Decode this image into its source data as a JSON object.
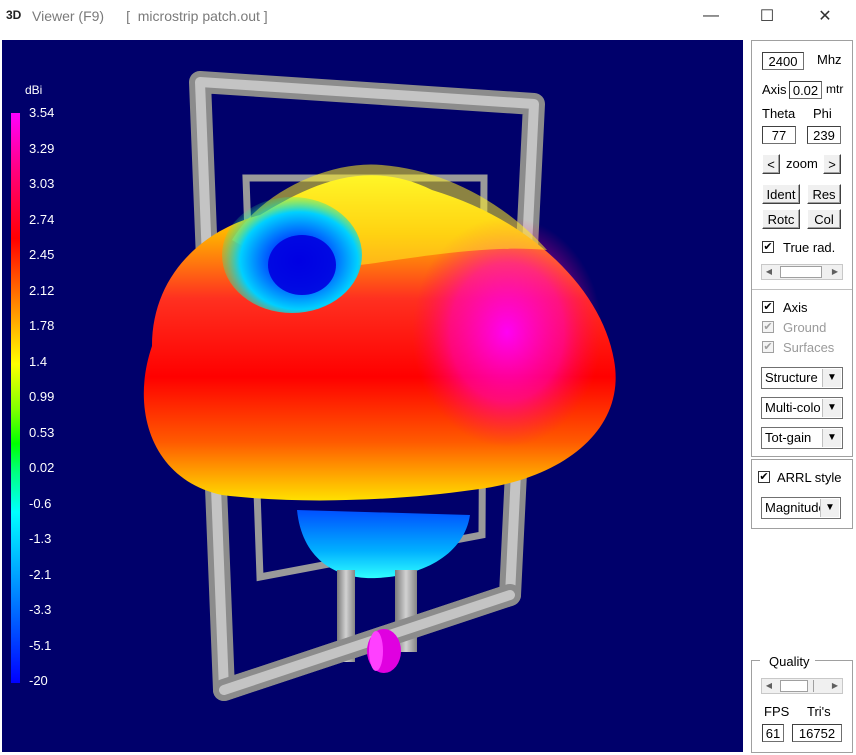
{
  "window": {
    "icon_text": "3D",
    "title": "Viewer (F9)",
    "file": "[  microstrip patch.out ]",
    "minimize_label": "—",
    "maximize_label": "☐",
    "close_label": "✕"
  },
  "colorbar": {
    "unit": "dBi",
    "ticks": [
      "3.54",
      "3.29",
      "3.03",
      "2.74",
      "2.45",
      "2.12",
      "1.78",
      "1.4",
      "0.99",
      "0.53",
      "0.02",
      "-0.6",
      "-1.3",
      "-2.1",
      "-3.3",
      "-5.1",
      "-20"
    ]
  },
  "controls": {
    "freq_value": "2400",
    "freq_unit": "Mhz",
    "axis_label": "Axis",
    "axis_value": "0.02",
    "axis_unit": "mtr",
    "theta_label": "Theta",
    "phi_label": "Phi",
    "theta_value": "77",
    "phi_value": "239",
    "zoom_left": "<",
    "zoom_label": "zoom",
    "zoom_right": ">",
    "ident_label": "Ident",
    "res_label": "Res",
    "rotc_label": "Rotc",
    "col_label": "Col",
    "true_rad_label": "True rad.",
    "true_rad_checked": true,
    "axis_check_label": "Axis",
    "axis_checked": true,
    "ground_label": "Ground",
    "surfaces_label": "Surfaces",
    "structure_select": "Structure",
    "color_select": "Multi-colo",
    "gain_select": "Tot-gain",
    "arrl_label": "ARRL style",
    "arrl_checked": true,
    "magnitude_select": "Magnitude",
    "quality_label": "Quality",
    "fps_label": "FPS",
    "tris_label": "Tri's",
    "fps_value": "61",
    "tris_value": "16752"
  },
  "colors": {
    "viewport_bg": "#00006b",
    "structure": "#a8a8a8",
    "feed": "#ff00ff"
  }
}
